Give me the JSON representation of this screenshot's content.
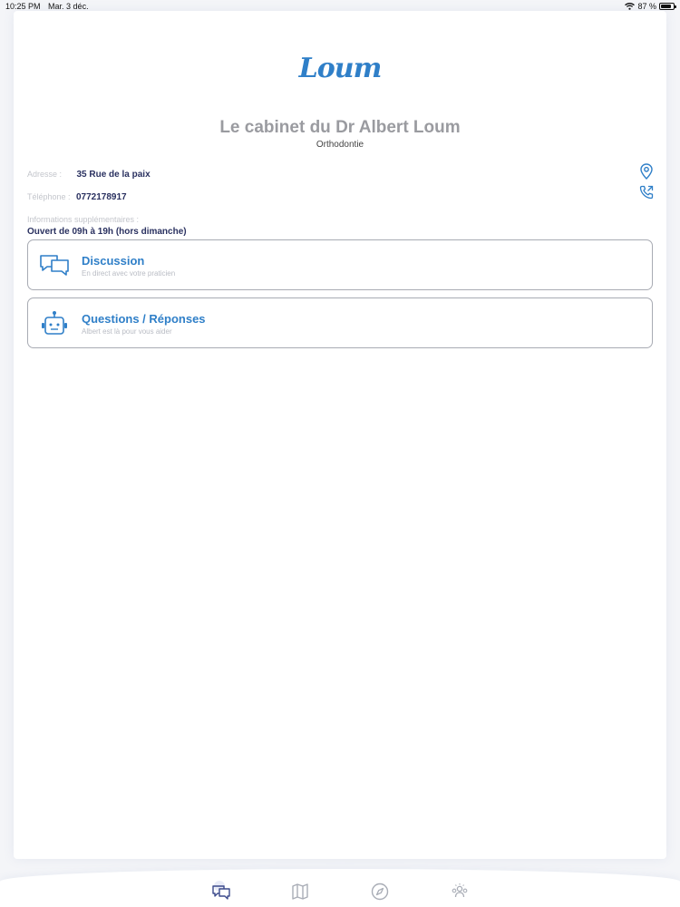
{
  "status_bar": {
    "time": "10:25 PM",
    "date": "Mar. 3 déc.",
    "battery_text": "87 %",
    "battery_level": 0.87,
    "wifi_icon": "wifi-icon"
  },
  "header": {
    "logo_text": "Loum",
    "title": "Le cabinet du Dr Albert Loum",
    "subtitle": "Orthodontie"
  },
  "details": {
    "address_label": "Adresse :",
    "address_value": "35 Rue de la paix",
    "phone_label": "Téléphone :",
    "phone_value": "0772178917",
    "info_label": "Informations supplémentaires :",
    "info_value": "Ouvert de 09h à 19h (hors dimanche)"
  },
  "actions": [
    {
      "title": "Discussion",
      "subtitle": "En direct avec votre praticien",
      "icon": "chat-bubbles-icon"
    },
    {
      "title": "Questions / Réponses",
      "subtitle": "Albert est là pour vous aider",
      "icon": "robot-icon"
    }
  ],
  "tabbar": {
    "items": [
      "chat-tab-icon",
      "map-tab-icon",
      "compass-tab-icon",
      "team-tab-icon"
    ],
    "active_index": 0
  },
  "colors": {
    "accent": "#2f7fc8",
    "dark_text": "#2a3160",
    "muted": "#c4c6cc",
    "tab_icon": "#a9adb6",
    "tab_active": "#3c4a8c"
  }
}
